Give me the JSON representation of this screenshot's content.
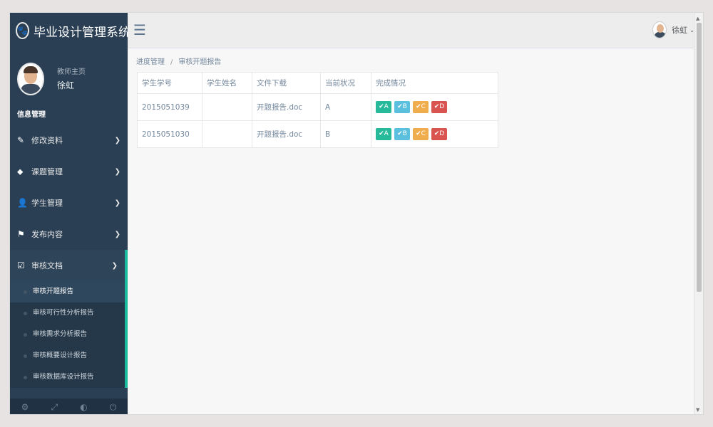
{
  "brand": {
    "title": "毕业设计管理系统",
    "logo_icon": "paw-icon"
  },
  "profile": {
    "welcome": "教师主页",
    "name": "徐虹"
  },
  "sidebar": {
    "section": "信息管理",
    "items": [
      {
        "label": "修改资料",
        "icon": "edit-icon"
      },
      {
        "label": "课题管理",
        "icon": "tags-icon"
      },
      {
        "label": "学生管理",
        "icon": "user-icon"
      },
      {
        "label": "发布内容",
        "icon": "flag-icon"
      },
      {
        "label": "审核文档",
        "icon": "check-square-icon"
      }
    ],
    "submenu": [
      {
        "label": "审核开题报告"
      },
      {
        "label": "审核可行性分析报告"
      },
      {
        "label": "审核需求分析报告"
      },
      {
        "label": "审核概要设计报告"
      },
      {
        "label": "审核数据库设计报告"
      }
    ]
  },
  "topnav": {
    "user_name": "徐虹",
    "menu_icon": "hamburger-icon"
  },
  "breadcrumb": {
    "parent": "进度管理",
    "separator": "/",
    "current": "审核开题报告"
  },
  "table": {
    "headers": [
      "学生学号",
      "学生姓名",
      "文件下载",
      "当前状况",
      "完成情况"
    ],
    "rows": [
      {
        "id": "2015051039",
        "name": "",
        "file": "开题报告.doc",
        "status": "A"
      },
      {
        "id": "2015051030",
        "name": "",
        "file": "开题报告.doc",
        "status": "B"
      }
    ],
    "grade_buttons": [
      {
        "label": "✔A",
        "color": "#26b99a"
      },
      {
        "label": "✔B",
        "color": "#5bc0de"
      },
      {
        "label": "✔C",
        "color": "#f0ad4e"
      },
      {
        "label": "✔D",
        "color": "#d9534f"
      }
    ]
  },
  "colors": {
    "sidebar": "#2a3f54",
    "accent": "#1abb9c",
    "content_bg": "#f7f7f7"
  }
}
